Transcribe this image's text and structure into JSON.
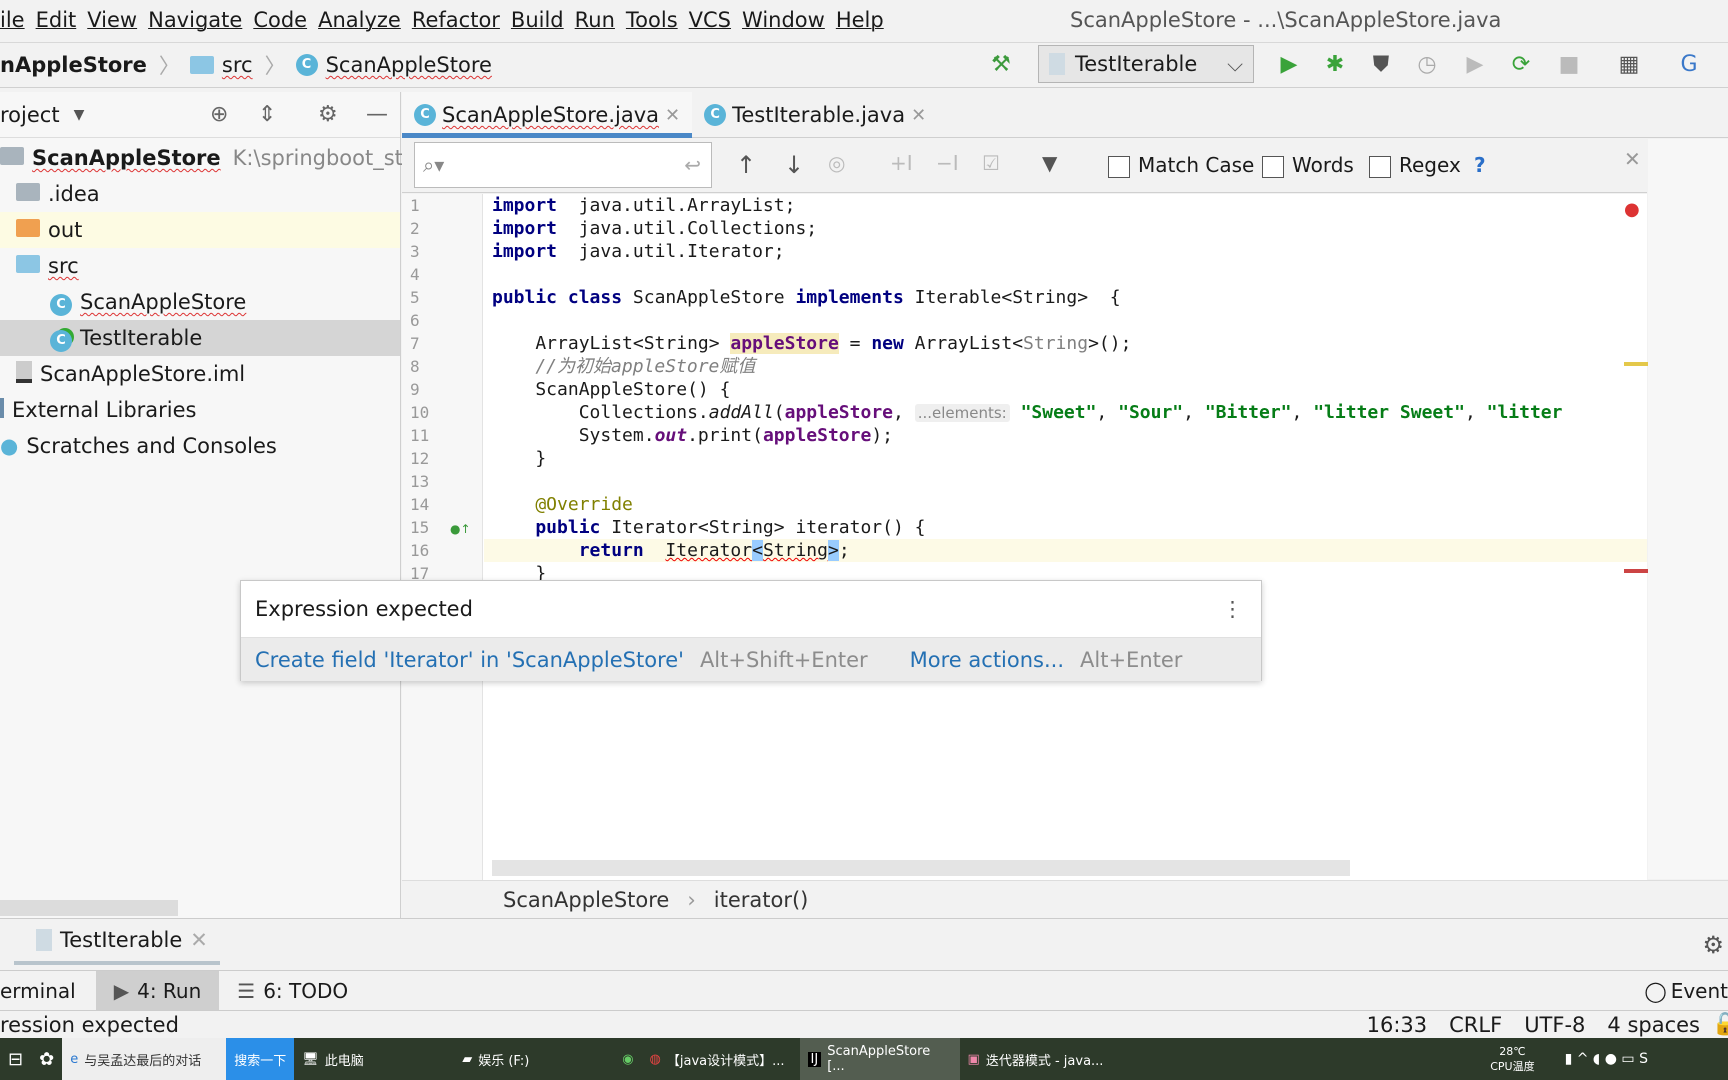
{
  "menu": {
    "items": [
      "ile",
      "Edit",
      "View",
      "Navigate",
      "Code",
      "Analyze",
      "Refactor",
      "Build",
      "Run",
      "Tools",
      "VCS",
      "Window",
      "Help"
    ],
    "window_title": "ScanAppleStore - ...\\ScanAppleStore.java"
  },
  "navbar": {
    "crumbs": [
      "nAppleStore",
      "src",
      "ScanAppleStore"
    ],
    "run_config": "TestIterable"
  },
  "project": {
    "title": "roject",
    "tree": [
      {
        "label": "ScanAppleStore",
        "extra": "K:\\springboot_stuc",
        "icon": "folder-icon",
        "indent": 0
      },
      {
        "label": ".idea",
        "icon": "folder-icon",
        "indent": 1
      },
      {
        "label": "out",
        "icon": "folder-orange-icon",
        "indent": 1
      },
      {
        "label": "src",
        "icon": "folder-source-icon",
        "indent": 1
      },
      {
        "label": "ScanAppleStore",
        "icon": "class-icon",
        "indent": 2
      },
      {
        "label": "TestIterable",
        "icon": "class-run-icon",
        "indent": 2
      },
      {
        "label": "ScanAppleStore.iml",
        "icon": "module-file-icon",
        "indent": 1
      },
      {
        "label": "External Libraries",
        "icon": "library-icon",
        "indent": 0
      },
      {
        "label": "Scratches and Consoles",
        "icon": "scratch-icon",
        "indent": 0
      }
    ]
  },
  "tabs": [
    {
      "label": "ScanAppleStore.java",
      "active": true
    },
    {
      "label": "TestIterable.java",
      "active": false
    }
  ],
  "search": {
    "value": "",
    "options": [
      "Match Case",
      "Words",
      "Regex"
    ],
    "help": "?"
  },
  "code": [
    [
      [
        "kw",
        "import"
      ],
      [
        "",
        "  java.util.ArrayList;"
      ]
    ],
    [
      [
        "kw",
        "import"
      ],
      [
        "",
        "  java.util.Collections;"
      ]
    ],
    [
      [
        "kw",
        "import"
      ],
      [
        "",
        "  java.util.Iterator;"
      ]
    ],
    [],
    [
      [
        "kw",
        "public class "
      ],
      [
        "",
        "ScanAppleStore "
      ],
      [
        "kw",
        "implements "
      ],
      [
        "",
        "Iterable<String>  {"
      ]
    ],
    [],
    [
      [
        "",
        "    ArrayList<String> "
      ],
      [
        "fld hl",
        "appleStore"
      ],
      [
        "",
        " = "
      ],
      [
        "kw",
        "new "
      ],
      [
        "",
        "ArrayList<"
      ],
      [
        "gen",
        "String"
      ],
      [
        "",
        ">();"
      ]
    ],
    [
      [
        "cmt",
        "    //为初始appleStore赋值"
      ]
    ],
    [
      [
        "",
        "    ScanAppleStore() {"
      ]
    ],
    [
      [
        "",
        "        Collections."
      ],
      [
        "it",
        "addAll"
      ],
      [
        "",
        "("
      ],
      [
        "fld",
        "appleStore"
      ],
      [
        "",
        ", "
      ],
      [
        "hint",
        "...elements:"
      ],
      [
        "",
        " "
      ],
      [
        "str",
        "\"Sweet\""
      ],
      [
        "",
        ", "
      ],
      [
        "str",
        "\"Sour\""
      ],
      [
        "",
        ", "
      ],
      [
        "str",
        "\"Bitter\""
      ],
      [
        "",
        ", "
      ],
      [
        "str",
        "\"litter Sweet\""
      ],
      [
        "",
        ", "
      ],
      [
        "str",
        "\"litter"
      ]
    ],
    [
      [
        "",
        "        System."
      ],
      [
        "itf",
        "out"
      ],
      [
        "",
        ".print("
      ],
      [
        "fld",
        "appleStore"
      ],
      [
        "",
        ");"
      ]
    ],
    [
      [
        "",
        "    }"
      ]
    ],
    [],
    [
      [
        "ann",
        "    @Override"
      ]
    ],
    [
      [
        "kw",
        "    public "
      ],
      [
        "",
        "Iterator<String> iterator() {"
      ]
    ],
    [
      [
        "kw",
        "        return"
      ],
      [
        "",
        "  "
      ],
      [
        "err",
        "Iterator"
      ],
      [
        "brk",
        "<"
      ],
      [
        "err",
        "String"
      ],
      [
        "brk",
        ">"
      ],
      [
        "",
        ";"
      ]
    ],
    [
      [
        "",
        "    }"
      ]
    ]
  ],
  "popup": {
    "message": "Expression expected",
    "fix": "Create field 'Iterator' in 'ScanAppleStore'",
    "fix_shortcut": "Alt+Shift+Enter",
    "more": "More actions...",
    "more_shortcut": "Alt+Enter"
  },
  "editor_breadcrumb": [
    "ScanAppleStore",
    "iterator()"
  ],
  "run_window": {
    "tab": "TestIterable"
  },
  "bottom_tabs": [
    "erminal",
    "4: Run",
    "6: TODO"
  ],
  "event_log": "Event",
  "status": {
    "message": "ression expected",
    "position": "16:33",
    "line_sep": "CRLF",
    "encoding": "UTF-8",
    "indent": "4 spaces"
  },
  "taskbar": {
    "search_text": "与吴孟达最后的对话",
    "search_btn": "搜索一下",
    "items": [
      "此电脑",
      "娱乐 (F:)",
      "【java设计模式】...",
      "ScanAppleStore [...",
      "迭代器模式 - java..."
    ],
    "temp": "28℃",
    "temp_label": "CPU温度"
  }
}
